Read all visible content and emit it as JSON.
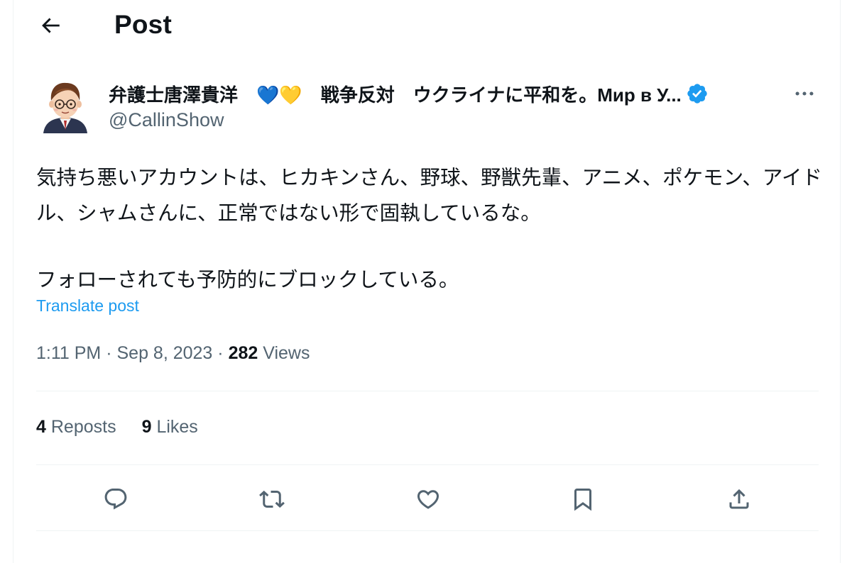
{
  "header": {
    "title": "Post"
  },
  "author": {
    "display_name": "弁護士唐澤貴洋　💙💛　戦争反対　ウクライナに平和を。Мир в У...",
    "handle": "@CallinShow"
  },
  "tweet": {
    "paragraphs": [
      "気持ち悪いアカウントは、ヒカキンさん、野球、野獣先輩、アニメ、ポケモン、アイドル、シャムさんに、正常ではない形で固執しているな。",
      "フォローされても予防的にブロックしている。"
    ],
    "translate_label": "Translate post",
    "time": "1:11 PM",
    "date": "Sep 8, 2023",
    "separator": "·",
    "views_count": "282",
    "views_label": "Views"
  },
  "stats": {
    "reposts_count": "4",
    "reposts_label": "Reposts",
    "likes_count": "9",
    "likes_label": "Likes"
  },
  "colors": {
    "accent": "#1d9bf0",
    "text": "#0f1419",
    "secondary": "#536471",
    "divider": "#eff3f4"
  },
  "icons": [
    "back-arrow-icon",
    "verified-badge-icon",
    "more-icon",
    "reply-icon",
    "repost-icon",
    "like-icon",
    "bookmark-icon",
    "share-icon"
  ]
}
